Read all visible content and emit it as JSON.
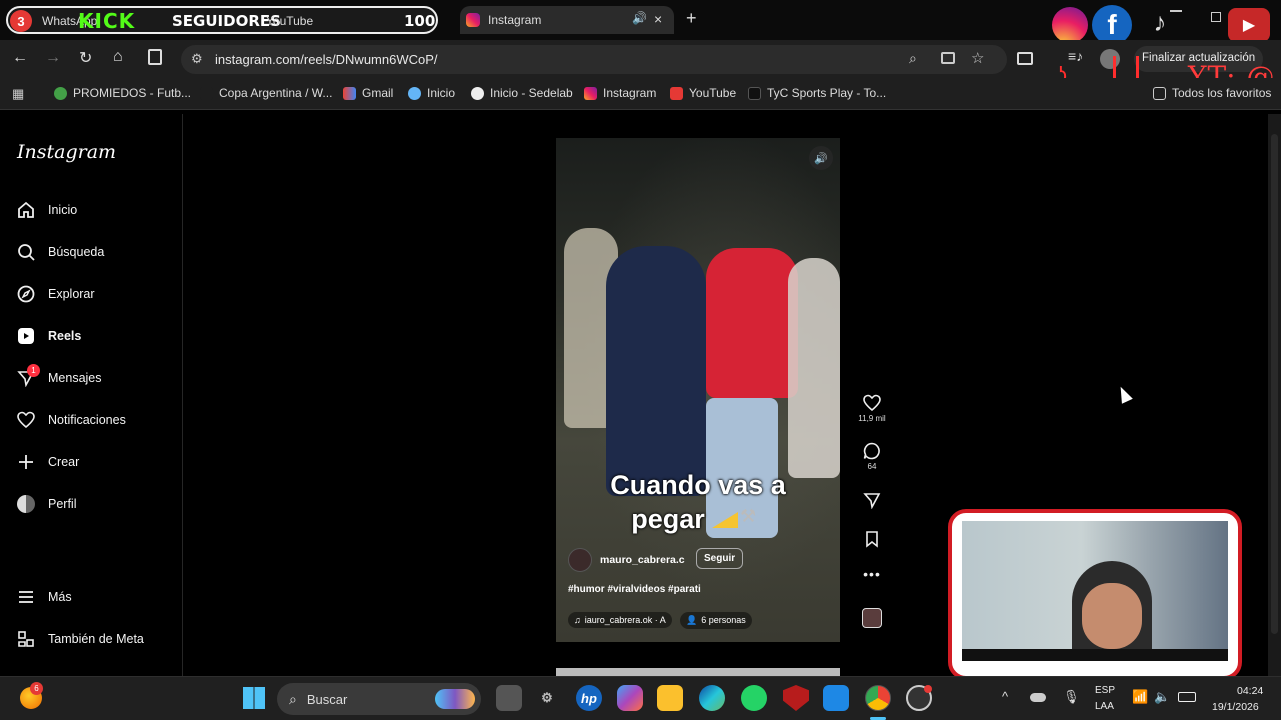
{
  "browser": {
    "tab1": {
      "badge": "3",
      "title": "WhatsApp",
      "tail": "YouTube",
      "overlay_kick": "KICK",
      "overlay_seguidores": "SEGUIDORES",
      "overlay_count": "100"
    },
    "tab2": {
      "title": "Instagram"
    },
    "address": "instagram.com/reels/DNwumn6WCoP/",
    "update_button": "Finalizar actualización",
    "stream_overlay_text": "YT: @",
    "bookmarks": [
      "PROMIEDOS - Futb...",
      "Copa Argentina / W...",
      "Gmail",
      "Inicio",
      "Inicio - Sedelab",
      "Instagram",
      "YouTube",
      "TyC Sports Play - To..."
    ],
    "bookmarks_folder": "Todos los favoritos"
  },
  "instagram": {
    "logo": "Instagram",
    "nav": [
      {
        "label": "Inicio",
        "icon": "home-icon"
      },
      {
        "label": "Búsqueda",
        "icon": "search-icon"
      },
      {
        "label": "Explorar",
        "icon": "compass-icon"
      },
      {
        "label": "Reels",
        "icon": "reels-icon"
      },
      {
        "label": "Mensajes",
        "icon": "messenger-icon",
        "badge": "1"
      },
      {
        "label": "Notificaciones",
        "icon": "heart-icon"
      },
      {
        "label": "Crear",
        "icon": "plus-icon"
      },
      {
        "label": "Perfil",
        "icon": "avatar-icon"
      }
    ],
    "more": "Más",
    "meta": "También de Meta",
    "reel": {
      "caption_line1": "Cuando vas a",
      "caption_line2": "pegar",
      "username": "mauro_cabrera.c",
      "follow": "Seguir",
      "hashtags": "#humor #viralvideos #parati",
      "audio": "iauro_cabrera.ok · A",
      "people": "6 personas",
      "likes": "11,9 mil",
      "comments": "64"
    }
  },
  "taskbar": {
    "notification_badge": "6",
    "search_placeholder": "Buscar",
    "lang1": "ESP",
    "lang2": "LAA",
    "time": "04:24",
    "date": "19/1/2026"
  }
}
